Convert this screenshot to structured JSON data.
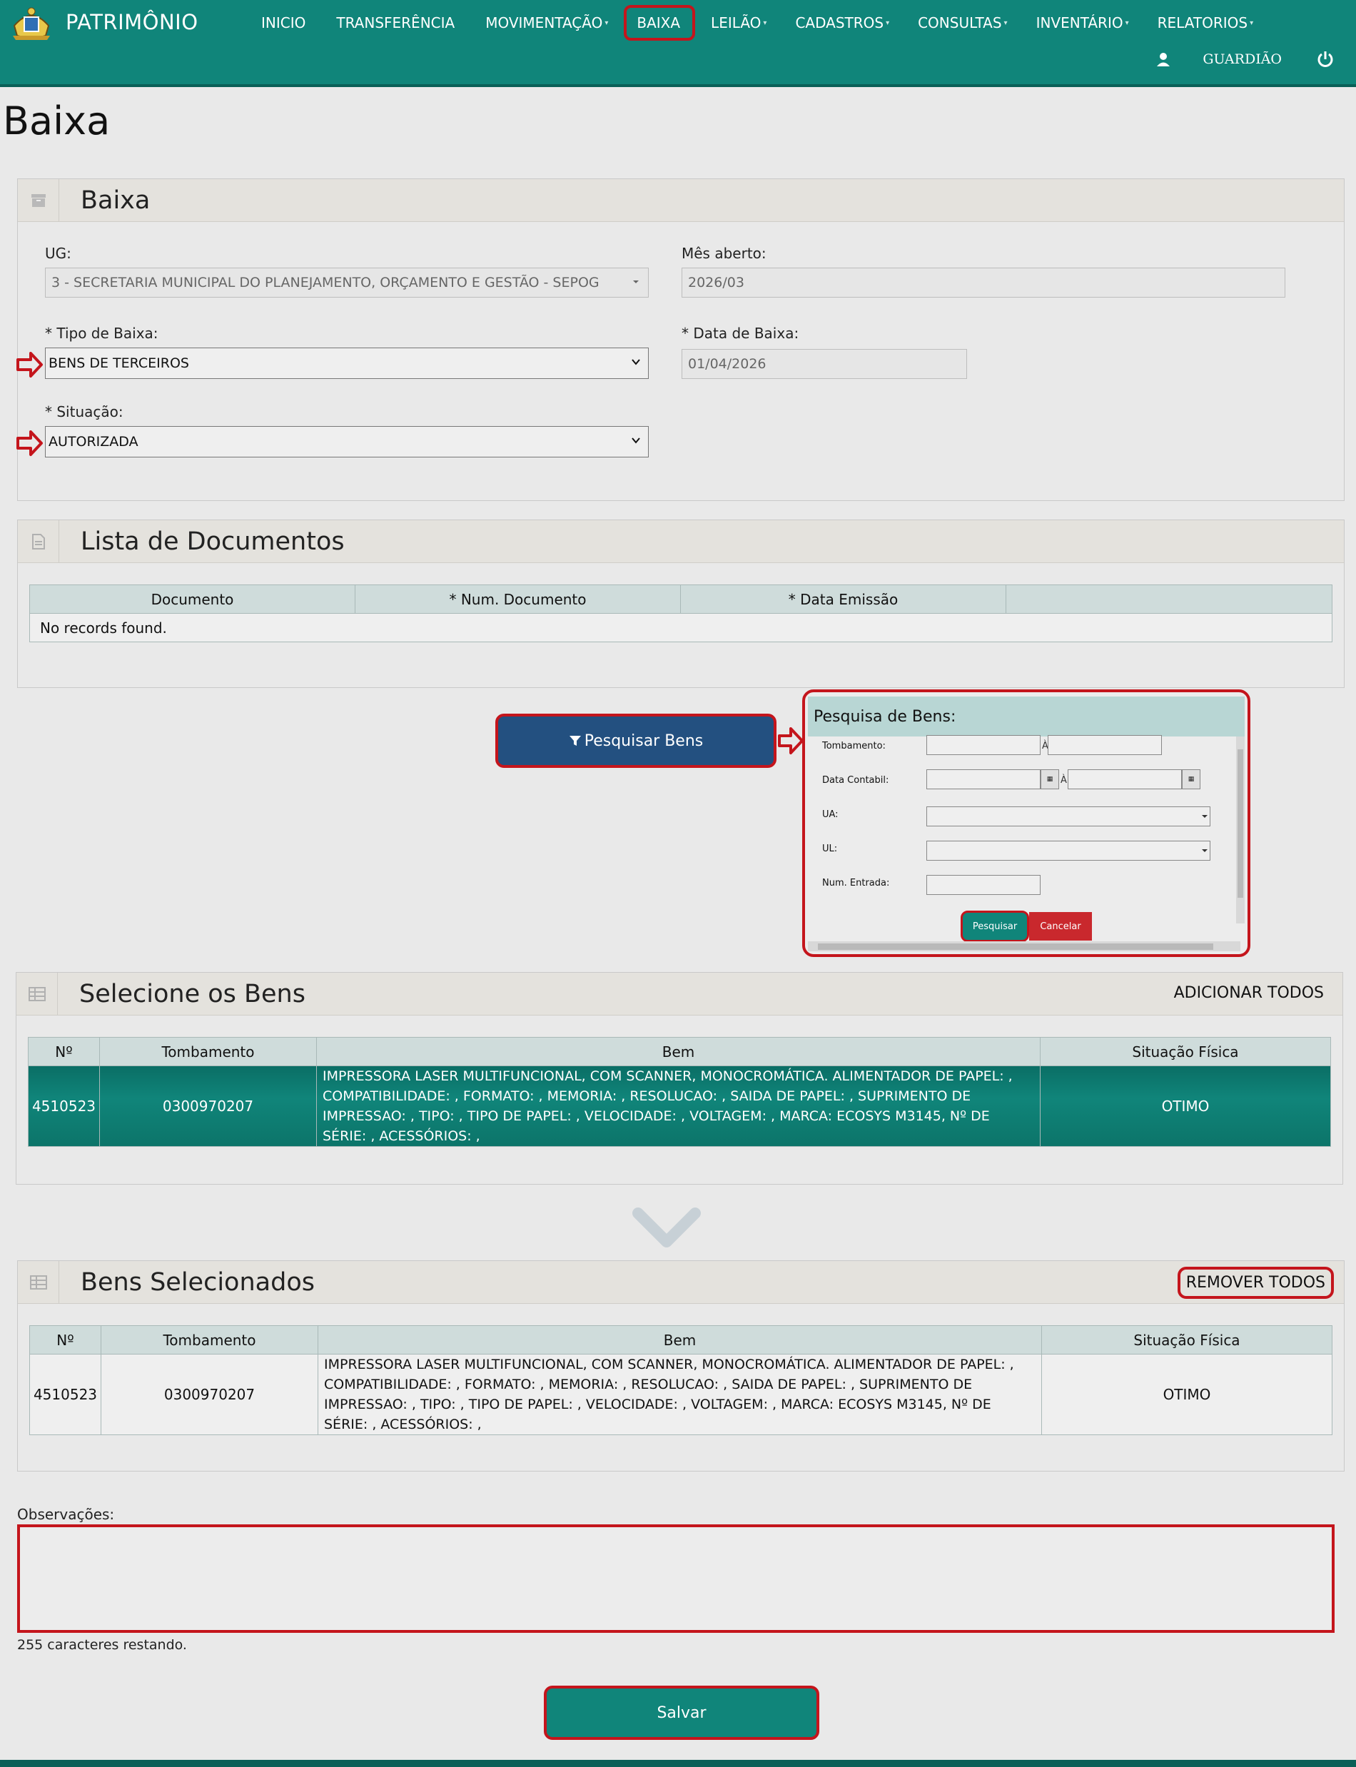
{
  "app": {
    "brand": "PATRIMÔNIO",
    "user": "GUARDIÃO",
    "page_title": "Baixa"
  },
  "nav": [
    {
      "label": "INICIO",
      "caret": ""
    },
    {
      "label": "TRANSFERÊNCIA",
      "caret": ""
    },
    {
      "label": "MOVIMENTAÇÃO",
      "caret": "▾"
    },
    {
      "label": "BAIXA",
      "caret": ""
    },
    {
      "label": "LEILÃO",
      "caret": "▾"
    },
    {
      "label": "CADASTROS",
      "caret": "▾"
    },
    {
      "label": "CONSULTAS",
      "caret": "▾"
    },
    {
      "label": "INVENTÁRIO",
      "caret": "▾"
    },
    {
      "label": "RELATORIOS",
      "caret": "▾"
    }
  ],
  "baixa": {
    "title": "Baixa",
    "ug_label": "UG:",
    "ug_value": "3 - SECRETARIA MUNICIPAL DO PLANEJAMENTO, ORÇAMENTO E GESTÃO - SEPOG",
    "mes_label": "Mês aberto:",
    "mes_value": "2026/03",
    "tipo_label": "* Tipo de Baixa:",
    "tipo_value": "BENS DE TERCEIROS",
    "data_label": "* Data de Baixa:",
    "data_value": "01/04/2026",
    "situacao_label": "* Situação:",
    "situacao_value": "AUTORIZADA"
  },
  "documentos": {
    "title": "Lista de Documentos",
    "columns": [
      "Documento",
      "* Num. Documento",
      "* Data Emissão",
      ""
    ],
    "empty": "No records found."
  },
  "search_button": "Pesquisar Bens",
  "pesquisa": {
    "title": "Pesquisa de Bens:",
    "tombamento_label": "Tombamento:",
    "data_label": "Data Contabil:",
    "ua_label": "UA:",
    "ul_label": "UL:",
    "entrada_label": "Num. Entrada:",
    "sep": "À",
    "cal": "▦",
    "ok": "Pesquisar",
    "cancel": "Cancelar"
  },
  "selecione": {
    "title": "Selecione os Bens",
    "action": "ADICIONAR TODOS",
    "columns": [
      "Nº",
      "Tombamento",
      "Bem",
      "Situação Física"
    ],
    "rows": [
      {
        "num": "4510523",
        "tombamento": "0300970207",
        "bem": "IMPRESSORA LASER MULTIFUNCIONAL, COM SCANNER, MONOCROMÁTICA. ALIMENTADOR DE PAPEL: , COMPATIBILIDADE: , FORMATO: , MEMORIA: , RESOLUCAO: , SAIDA DE PAPEL: , SUPRIMENTO DE IMPRESSAO: , TIPO: , TIPO DE PAPEL: , VELOCIDADE: , VOLTAGEM: , MARCA: ECOSYS M3145, Nº DE SÉRIE: , ACESSÓRIOS: ,",
        "situacao": "OTIMO"
      }
    ]
  },
  "selecionados": {
    "title": "Bens Selecionados",
    "action": "REMOVER TODOS",
    "columns": [
      "Nº",
      "Tombamento",
      "Bem",
      "Situação Física"
    ],
    "rows": [
      {
        "num": "4510523",
        "tombamento": "0300970207",
        "bem": "IMPRESSORA LASER MULTIFUNCIONAL, COM SCANNER, MONOCROMÁTICA. ALIMENTADOR DE PAPEL: , COMPATIBILIDADE: , FORMATO: , MEMORIA: , RESOLUCAO: , SAIDA DE PAPEL: , SUPRIMENTO DE IMPRESSAO: , TIPO: , TIPO DE PAPEL: , VELOCIDADE: , VOLTAGEM: , MARCA: ECOSYS M3145, Nº DE SÉRIE: , ACESSÓRIOS: ,",
        "situacao": "OTIMO"
      }
    ]
  },
  "observacoes": {
    "label": "Observações:",
    "value": "",
    "chars_left": "255 caracteres restando."
  },
  "save_button": "Salvar",
  "colors": {
    "brand": "#10857a",
    "highlight": "#c4151c",
    "primary_button": "#235080",
    "cancel": "#c9282d"
  },
  "icons": [
    "crest-logo",
    "user-icon",
    "power-icon",
    "archive-icon",
    "document-icon",
    "grid-icon",
    "filter-icon",
    "chevron-down-icon",
    "right-arrow-icon",
    "calendar-icon"
  ]
}
